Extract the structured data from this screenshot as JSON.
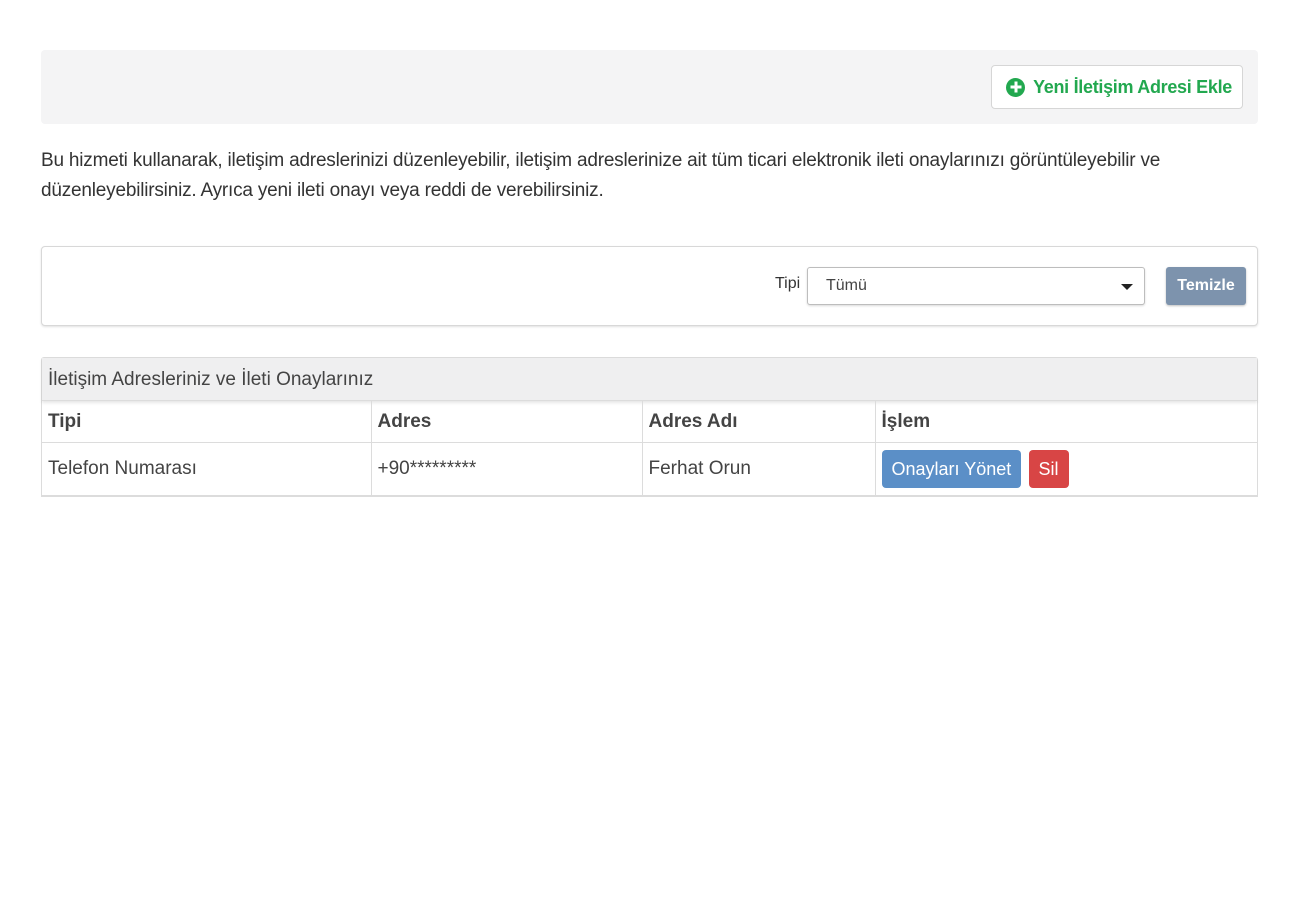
{
  "toolbar": {
    "add_button_label": "Yeni İletişim Adresi Ekle",
    "add_button_icon": "plus-circle-icon"
  },
  "description": "Bu hizmeti kullanarak, iletişim adreslerinizi düzenleyebilir, iletişim adreslerinize ait tüm ticari elektronik ileti onaylarınızı görüntüleyebilir ve düzenleyebilirsiniz. Ayrıca yeni ileti onayı veya reddi de verebilirsiniz.",
  "filter": {
    "type_label": "Tipi",
    "type_selected": "Tümü",
    "clear_label": "Temizle"
  },
  "table": {
    "heading": "İletişim Adresleriniz ve İleti Onaylarınız",
    "columns": [
      "Tipi",
      "Adres",
      "Adres Adı",
      "İşlem"
    ],
    "rows": [
      {
        "type": "Telefon Numarası",
        "address": "+90*********",
        "address_name": "Ferhat Orun",
        "manage_label": "Onayları Yönet",
        "delete_label": "Sil"
      }
    ]
  },
  "colors": {
    "add_green": "#22a84f",
    "clear_button": "#7d93ad",
    "manage_button": "#5b8fc7",
    "delete_button": "#d84545"
  }
}
